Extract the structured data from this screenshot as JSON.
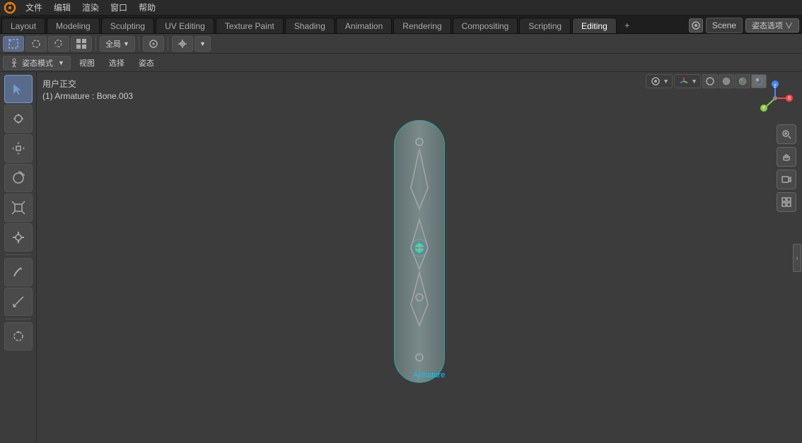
{
  "app": {
    "title": "Blender",
    "logo": "⬡"
  },
  "topmenu": {
    "items": [
      "文件",
      "编辑",
      "渲染",
      "窗口",
      "帮助"
    ]
  },
  "workspace_tabs": [
    {
      "label": "Layout",
      "active": false
    },
    {
      "label": "Modeling",
      "active": false
    },
    {
      "label": "Sculpting",
      "active": false
    },
    {
      "label": "UV Editing",
      "active": false
    },
    {
      "label": "Texture Paint",
      "active": false
    },
    {
      "label": "Shading",
      "active": false
    },
    {
      "label": "Animation",
      "active": false
    },
    {
      "label": "Rendering",
      "active": false
    },
    {
      "label": "Compositing",
      "active": false
    },
    {
      "label": "Scripting",
      "active": false
    }
  ],
  "editing_label": "Editing",
  "scene_selector": "Scene",
  "properties_btn": "姿态选项 ∨",
  "toolbar": {
    "select_box": "⬚",
    "move": "↖",
    "transform": "⊕",
    "global": "全局",
    "proportional": "⊙",
    "snap": "⊞",
    "cursor": "⊛"
  },
  "mode_bar": {
    "mode": "姿态模式",
    "view": "视图",
    "select": "选择",
    "pose": "姿态"
  },
  "viewport_info": {
    "user_ortho": "用户正交",
    "object_info": "(1) Armature : Bone.003"
  },
  "left_tools": [
    {
      "icon": "↖",
      "name": "select",
      "active": true
    },
    {
      "icon": "⊕",
      "name": "cursor",
      "active": false
    },
    {
      "icon": "⊞",
      "name": "move",
      "active": false
    },
    {
      "icon": "↻",
      "name": "rotate",
      "active": false
    },
    {
      "icon": "⊡",
      "name": "scale",
      "active": false
    },
    {
      "icon": "⊗",
      "name": "transform",
      "active": false
    },
    {
      "separator": true
    },
    {
      "icon": "✎",
      "name": "annotate",
      "active": false
    },
    {
      "icon": "⊾",
      "name": "measure",
      "active": false
    },
    {
      "separator": true
    },
    {
      "icon": "⊘",
      "name": "pose",
      "active": false
    }
  ],
  "shading_modes": [
    "●",
    "○",
    "◎",
    "◉"
  ],
  "overlay_buttons": [
    "👁",
    "⟳",
    "📷",
    "▦"
  ],
  "armature_label": "Armature",
  "viewport_header": {
    "items": [
      "视图",
      "选择",
      "姿态"
    ]
  },
  "right_panel_toggle": "›",
  "gizmo": {
    "x": "X",
    "y": "Y",
    "z": "Z",
    "color_x": "#ff4444",
    "color_y": "#88cc44",
    "color_z": "#4488ff"
  }
}
